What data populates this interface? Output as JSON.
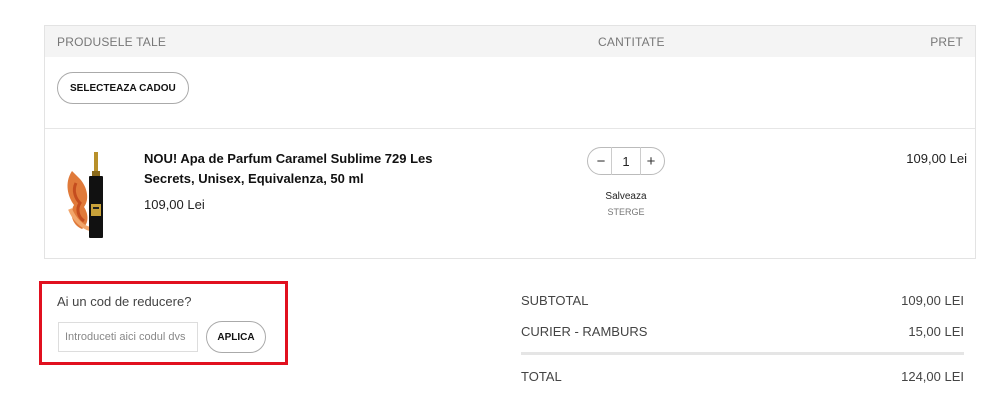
{
  "cart": {
    "headers": {
      "products": "PRODUSELE TALE",
      "quantity": "CANTITATE",
      "price": "PRET"
    },
    "gift_button": "SELECTEAZA CADOU",
    "item": {
      "name": "NOU! Apa de Parfum Caramel Sublime 729 Les Secrets, Unisex, Equivalenza, 50 ml",
      "unit_price": "109,00 Lei",
      "quantity": "1",
      "minus": "−",
      "plus": "+",
      "save_label": "Salveaza",
      "delete_label": "STERGE",
      "line_total": "109,00 Lei"
    }
  },
  "discount": {
    "title": "Ai un cod de reducere?",
    "placeholder": "Introduceti aici codul dvs",
    "apply_label": "APLICA",
    "highlight_color": "#e1101f"
  },
  "totals": {
    "subtotal_label": "SUBTOTAL",
    "subtotal_value": "109,00 LEI",
    "shipping_label": "CURIER - RAMBURS",
    "shipping_value": "15,00 LEI",
    "total_label": "TOTAL",
    "total_value": "124,00 LEI"
  }
}
